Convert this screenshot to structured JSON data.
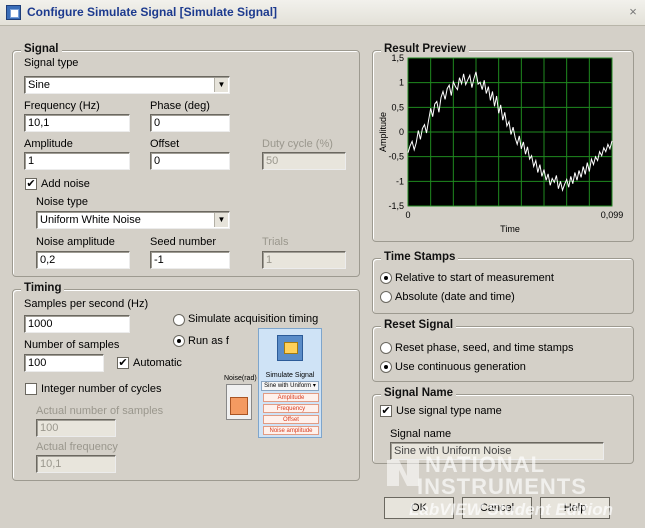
{
  "window": {
    "title": "Configure Simulate Signal [Simulate Signal]",
    "close_glyph": "×"
  },
  "signal": {
    "legend": "Signal",
    "signal_type_label": "Signal type",
    "signal_type_value": "Sine",
    "frequency_label": "Frequency (Hz)",
    "frequency_value": "10,1",
    "phase_label": "Phase (deg)",
    "phase_value": "0",
    "amplitude_label": "Amplitude",
    "amplitude_value": "1",
    "offset_label": "Offset",
    "offset_value": "0",
    "duty_cycle_label": "Duty cycle (%)",
    "duty_cycle_value": "50",
    "add_noise_label": "Add noise",
    "add_noise_checked": true,
    "noise_type_label": "Noise type",
    "noise_type_value": "Uniform White Noise",
    "noise_amplitude_label": "Noise amplitude",
    "noise_amplitude_value": "0,2",
    "seed_label": "Seed number",
    "seed_value": "-1",
    "trials_label": "Trials",
    "trials_value": "1"
  },
  "timing": {
    "legend": "Timing",
    "samples_per_second_label": "Samples per second (Hz)",
    "samples_per_second_value": "1000",
    "simulate_acq_label": "Simulate acquisition timing",
    "run_as_label": "Run as f",
    "number_of_samples_label": "Number of samples",
    "number_of_samples_value": "100",
    "automatic_label": "Automatic",
    "automatic_checked": true,
    "integer_cycles_label": "Integer number of cycles",
    "integer_cycles_checked": false,
    "actual_samples_label": "Actual number of samples",
    "actual_samples_value": "100",
    "actual_frequency_label": "Actual frequency",
    "actual_frequency_value": "10,1"
  },
  "node": {
    "title": "Simulate Signal",
    "subtitle": "Sine with Uniform ▾",
    "terminals": [
      "Amplitude",
      "Frequency",
      "Offset",
      "Noise amplitude"
    ],
    "left_label": "Noise(rad)"
  },
  "result_preview": {
    "legend": "Result Preview"
  },
  "chart_data": {
    "type": "line",
    "xlabel": "Time",
    "ylabel": "Amplitude",
    "xlim": [
      0,
      0.099
    ],
    "ylim": [
      -1.5,
      1.5
    ],
    "x_tick_labels": [
      "0",
      "0,099"
    ],
    "y_tick_labels": [
      "1,5",
      "1",
      "0,5",
      "0",
      "-0,5",
      "-1",
      "-1,5"
    ],
    "grid": true,
    "background": "#000000",
    "grid_color": "#1f8a1f",
    "line_color": "#ffffff",
    "series": [
      {
        "values": [
          -0.42,
          -0.28,
          -0.19,
          -0.36,
          -0.22,
          0.03,
          -0.15,
          0.07,
          0.15,
          -0.02,
          0.24,
          0.48,
          0.31,
          0.57,
          0.62,
          0.4,
          0.7,
          0.82,
          0.66,
          0.88,
          0.95,
          0.74,
          1.02,
          0.92,
          0.86,
          1.1,
          0.98,
          1.18,
          0.96,
          1.06,
          1.15,
          0.9,
          1.08,
          1.22,
          0.97,
          1.01,
          0.86,
          1.05,
          0.78,
          0.92,
          0.64,
          0.82,
          0.52,
          0.73,
          0.38,
          0.55,
          0.24,
          0.4,
          0.12,
          0.21,
          -0.05,
          0.1,
          -0.12,
          -0.25,
          -0.08,
          -0.34,
          -0.2,
          -0.45,
          -0.3,
          -0.55,
          -0.48,
          -0.7,
          -0.58,
          -0.82,
          -0.66,
          -0.9,
          -0.76,
          -0.98,
          -0.85,
          -1.08,
          -0.94,
          -1.02,
          -0.88,
          -1.15,
          -1.0,
          -1.18,
          -1.06,
          -0.96,
          -1.12,
          -0.9,
          -1.05,
          -0.82,
          -0.98,
          -0.78,
          -0.92,
          -0.7,
          -0.86,
          -0.62,
          -0.8,
          -0.55,
          -0.66,
          -0.5,
          -0.58,
          -0.4,
          -0.48,
          -0.32,
          -0.4,
          -0.25,
          -0.34,
          -0.18
        ]
      }
    ]
  },
  "time_stamps": {
    "legend": "Time Stamps",
    "relative_label": "Relative to start of measurement",
    "relative_selected": true,
    "absolute_label": "Absolute (date and time)",
    "absolute_selected": false
  },
  "reset_signal": {
    "legend": "Reset Signal",
    "reset_label": "Reset phase, seed, and time stamps",
    "reset_selected": false,
    "continuous_label": "Use continuous generation",
    "continuous_selected": true
  },
  "signal_name": {
    "legend": "Signal Name",
    "use_type_label": "Use signal type name",
    "use_type_checked": true,
    "name_label": "Signal name",
    "name_value": "Sine with Uniform Noise"
  },
  "buttons": {
    "ok": "OK",
    "cancel": "Cancel",
    "help": "Help"
  },
  "watermark": {
    "line1": "NATIONAL",
    "line2": "INSTRUMENTS",
    "line3": "LabVIEW Student Edition"
  }
}
